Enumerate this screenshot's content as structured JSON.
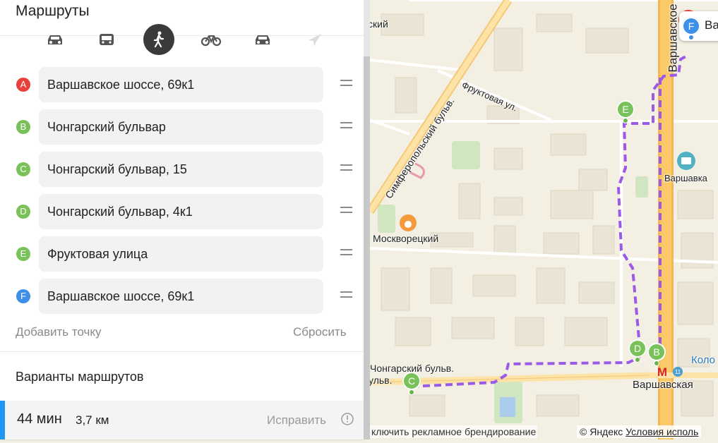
{
  "panel": {
    "title": "Маршруты",
    "modes": [
      {
        "icon": "car-icon",
        "active": false
      },
      {
        "icon": "bus-icon",
        "active": false
      },
      {
        "icon": "pedestrian-icon",
        "active": true
      },
      {
        "icon": "bicycle-icon",
        "active": false
      },
      {
        "icon": "taxi-icon",
        "active": false
      },
      {
        "icon": "plane-icon",
        "active": false
      }
    ],
    "waypoints": [
      {
        "letter": "A",
        "value": "Варшавское шоссе, 69к1",
        "color": "#e8413c"
      },
      {
        "letter": "B",
        "value": "Чонгарский бульвар",
        "color": "#79c25a"
      },
      {
        "letter": "C",
        "value": "Чонгарский бульвар, 15",
        "color": "#79c25a"
      },
      {
        "letter": "D",
        "value": "Чонгарский бульвар, 4к1",
        "color": "#79c25a"
      },
      {
        "letter": "E",
        "value": "Фруктовая улица",
        "color": "#79c25a"
      },
      {
        "letter": "F",
        "value": "Варшавское шоссе, 69к1",
        "color": "#3d8fe8"
      }
    ],
    "add_point": "Добавить точку",
    "reset": "Сбросить",
    "variants_title": "Варианты маршрутов",
    "route": {
      "time": "44 мин",
      "distance": "3,7 км",
      "fix": "Исправить",
      "accent": "#2196f3"
    }
  },
  "map": {
    "streets": {
      "simferopolsky": "Симферопольский бульв.",
      "fruktovaya": "Фруктовая ул.",
      "chongarsky": "Чонгарский бульв.",
      "chongarsky_cut": "ульв.",
      "varshavskoe": "Варшавское",
      "top_cut": "ский"
    },
    "pois": {
      "moskvoretsky": "Москворецкий",
      "varshavka": "Варшавка",
      "varshavskaya": "Варшавская",
      "kolo": "Коло"
    },
    "markers": [
      {
        "letter": "B",
        "color": "#79c25a"
      },
      {
        "letter": "C",
        "color": "#79c25a"
      },
      {
        "letter": "D",
        "color": "#79c25a"
      },
      {
        "letter": "E",
        "color": "#79c25a"
      },
      {
        "letter": "F",
        "color": "#3d8fe8"
      }
    ],
    "f_label": "Ва",
    "route_color": "#9b59e8",
    "metro_symbol": "М",
    "metro_line": "11",
    "ad_note": "ключить рекламное брендирование",
    "copyright": "© Яндекс",
    "terms": "Условия исполь"
  }
}
